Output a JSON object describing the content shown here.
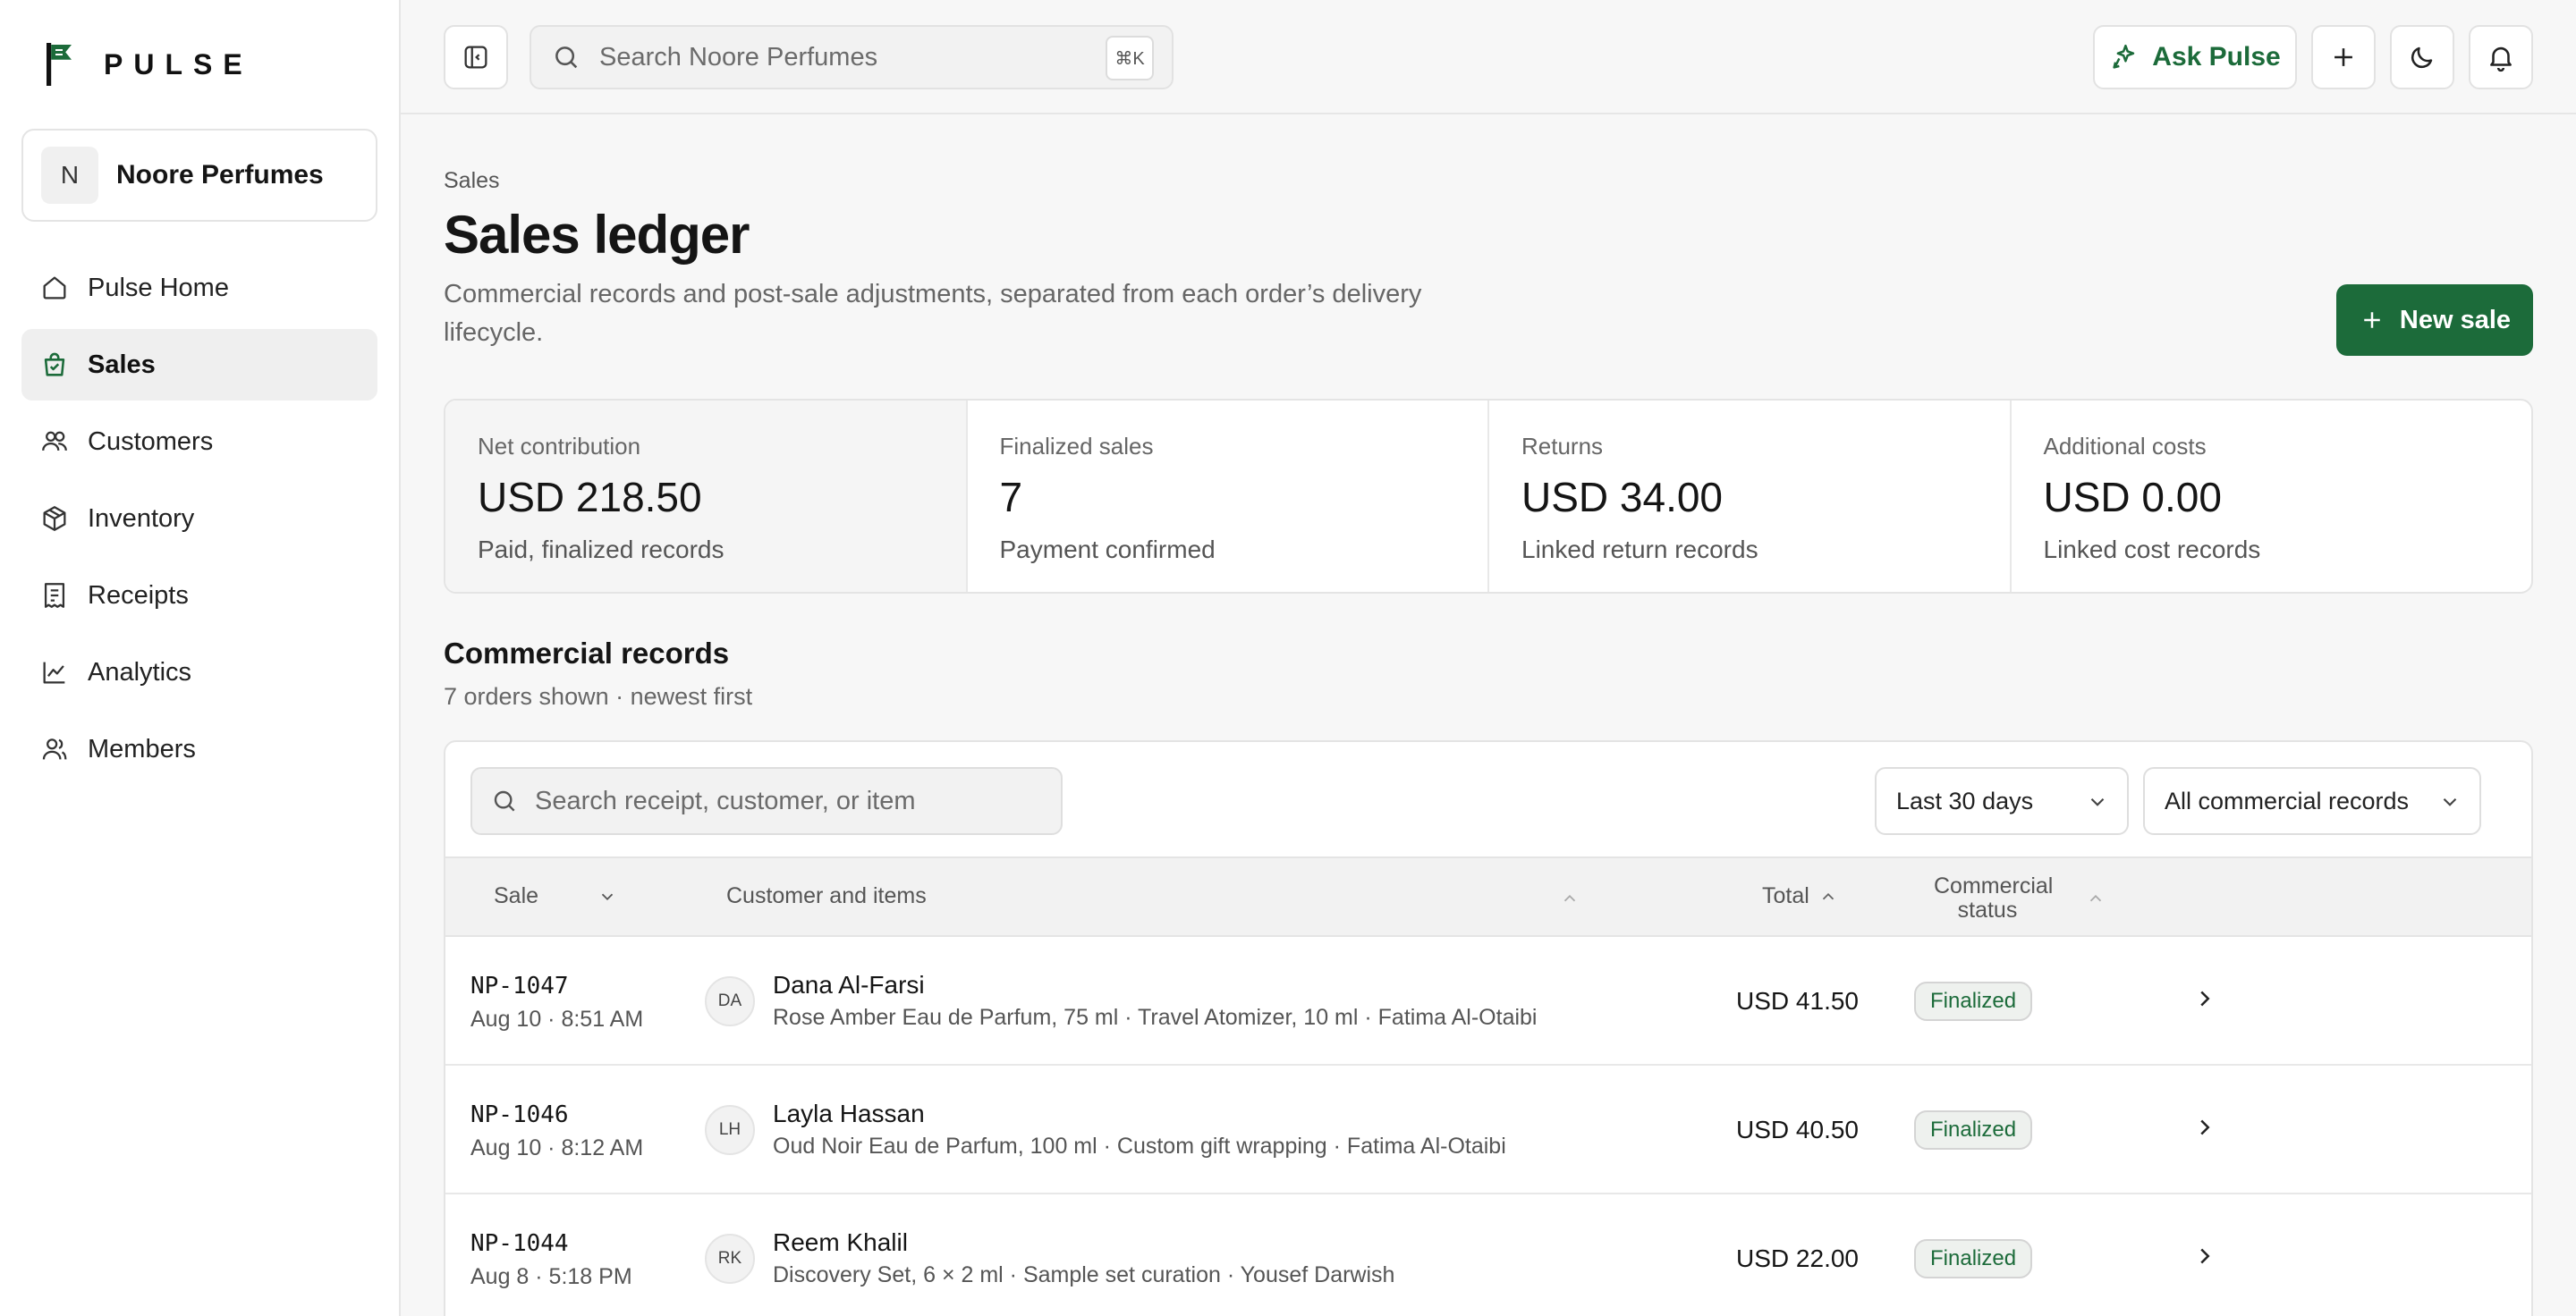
{
  "brand": {
    "name": "PULSE"
  },
  "workspace": {
    "initial": "N",
    "name": "Noore Perfumes"
  },
  "sidebar": {
    "items": [
      {
        "label": "Pulse Home",
        "icon": "home-icon",
        "active": false
      },
      {
        "label": "Sales",
        "icon": "shopping-bag-icon",
        "active": true
      },
      {
        "label": "Customers",
        "icon": "users-icon",
        "active": false
      },
      {
        "label": "Inventory",
        "icon": "box-icon",
        "active": false
      },
      {
        "label": "Receipts",
        "icon": "receipt-icon",
        "active": false
      },
      {
        "label": "Analytics",
        "icon": "line-chart-icon",
        "active": false
      },
      {
        "label": "Members",
        "icon": "members-icon",
        "active": false
      }
    ]
  },
  "topbar": {
    "search_placeholder": "Search Noore Perfumes",
    "shortcut": "⌘K",
    "ask_label": "Ask Pulse"
  },
  "page": {
    "breadcrumb": "Sales",
    "title": "Sales ledger",
    "description": "Commercial records and post-sale adjustments, separated from each order’s delivery lifecycle.",
    "new_sale_label": "New sale"
  },
  "stats": [
    {
      "label": "Net contribution",
      "value": "USD 218.50",
      "sub": "Paid, finalized records"
    },
    {
      "label": "Finalized sales",
      "value": "7",
      "sub": "Payment confirmed"
    },
    {
      "label": "Returns",
      "value": "USD 34.00",
      "sub": "Linked return records"
    },
    {
      "label": "Additional costs",
      "value": "USD 0.00",
      "sub": "Linked cost records"
    }
  ],
  "records": {
    "title": "Commercial records",
    "subtitle": "7 orders shown · newest first",
    "search_placeholder": "Search receipt, customer, or item",
    "range_filter": "Last 30 days",
    "type_filter": "All commercial records",
    "columns": {
      "sale": "Sale",
      "customer": "Customer and items",
      "total": "Total",
      "status": "Commercial status"
    },
    "rows": [
      {
        "id": "NP-1047",
        "date": "Aug 10 · 8:51 AM",
        "initials": "DA",
        "customer": "Dana Al-Farsi",
        "items": "Rose Amber Eau de Parfum, 75 ml · Travel Atomizer, 10 ml · Fatima Al-Otaibi",
        "total": "USD 41.50",
        "status": "Finalized"
      },
      {
        "id": "NP-1046",
        "date": "Aug 10 · 8:12 AM",
        "initials": "LH",
        "customer": "Layla Hassan",
        "items": "Oud Noir Eau de Parfum, 100 ml · Custom gift wrapping · Fatima Al-Otaibi",
        "total": "USD 40.50",
        "status": "Finalized"
      },
      {
        "id": "NP-1044",
        "date": "Aug 8 · 5:18 PM",
        "initials": "RK",
        "customer": "Reem Khalil",
        "items": "Discovery Set, 6 × 2 ml · Sample set curation · Yousef Darwish",
        "total": "USD 22.00",
        "status": "Finalized"
      }
    ]
  },
  "colors": {
    "accent": "#1c6b3a",
    "background": "#f7f7f7",
    "border": "#e4e4e4"
  }
}
